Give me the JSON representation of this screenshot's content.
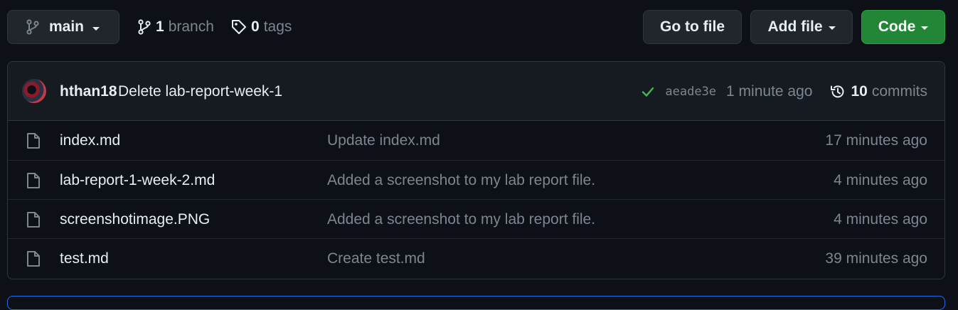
{
  "branch": {
    "current": "main",
    "branches_count": "1",
    "branches_label": "branch",
    "tags_count": "0",
    "tags_label": "tags"
  },
  "actions": {
    "go_to_file": "Go to file",
    "add_file": "Add file",
    "code": "Code"
  },
  "latest_commit": {
    "author": "hthan18",
    "message": "Delete lab-report-week-1",
    "sha": "aeade3e",
    "time": "1 minute ago",
    "commits_count": "10",
    "commits_label": "commits",
    "status": "success"
  },
  "files": [
    {
      "name": "index.md",
      "commit": "Update index.md",
      "time": "17 minutes ago"
    },
    {
      "name": "lab-report-1-week-2.md",
      "commit": "Added a screenshot to my lab report file.",
      "time": "4 minutes ago"
    },
    {
      "name": "screenshotimage.PNG",
      "commit": "Added a screenshot to my lab report file.",
      "time": "4 minutes ago"
    },
    {
      "name": "test.md",
      "commit": "Create test.md",
      "time": "39 minutes ago"
    }
  ],
  "colors": {
    "background": "#0d1117",
    "surface": "#161b22",
    "button_bg": "#21262d",
    "border": "#30363d",
    "text": "#e6edf3",
    "muted": "#7d8590",
    "primary": "#238636",
    "success": "#3fb950",
    "accent": "#1f6feb"
  },
  "icons": {
    "branch": "git-branch-icon",
    "tag": "tag-icon",
    "check": "check-icon",
    "history": "history-icon",
    "file": "file-icon"
  }
}
